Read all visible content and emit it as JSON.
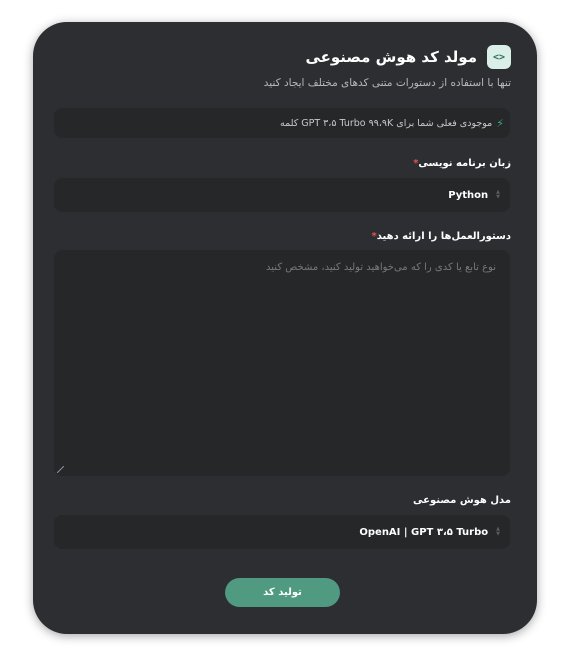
{
  "header": {
    "logo_glyph": "<>",
    "title": "مولد کد هوش مصنوعی",
    "subtitle": "تنها با استفاده از دستورات متنی کدهای مختلف ایجاد کنید"
  },
  "credit": {
    "icon": "bolt-icon",
    "text": "موجودی فعلی شما برای GPT ۳،۵ Turbo ۹۹،۹K کلمه"
  },
  "language_field": {
    "label": "زبان برنامه نویسی",
    "required_mark": "*",
    "value": "Python"
  },
  "instructions_field": {
    "label": "دستورالعمل‌ها را ارائه دهید",
    "required_mark": "*",
    "placeholder": "نوع تابع یا کدی را که می‌خواهید تولید کنید، مشخص کنید",
    "value": ""
  },
  "model_field": {
    "label": "مدل هوش مصنوعی",
    "value": "OpenAI | GPT ۳،۵ Turbo"
  },
  "submit_button": {
    "label": "تولید کد"
  },
  "colors": {
    "card_bg": "#2d2e31",
    "input_bg": "#262729",
    "accent": "#4f9a80",
    "required": "#e0554d"
  }
}
